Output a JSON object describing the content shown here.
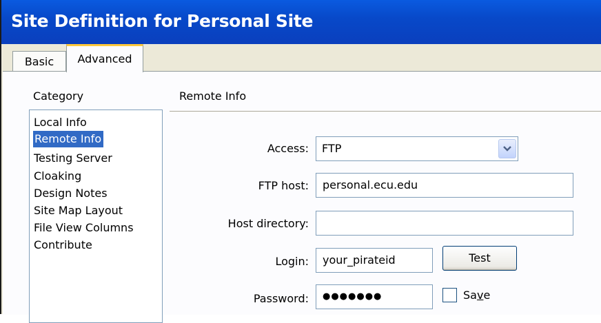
{
  "window": {
    "title": "Site Definition for Personal Site"
  },
  "tabs": [
    {
      "label": "Basic",
      "active": false
    },
    {
      "label": "Advanced",
      "active": true
    }
  ],
  "category": {
    "label": "Category",
    "items": [
      {
        "label": "Local Info",
        "selected": false
      },
      {
        "label": "Remote Info",
        "selected": true
      },
      {
        "label": "Testing Server",
        "selected": false
      },
      {
        "label": "Cloaking",
        "selected": false
      },
      {
        "label": "Design Notes",
        "selected": false
      },
      {
        "label": "Site Map Layout",
        "selected": false
      },
      {
        "label": "File View Columns",
        "selected": false
      },
      {
        "label": "Contribute",
        "selected": false
      }
    ]
  },
  "remote": {
    "heading": "Remote Info",
    "access_label": "Access:",
    "access_value": "FTP",
    "ftp_host_label": "FTP host:",
    "ftp_host_value": "personal.ecu.edu",
    "host_dir_label": "Host directory:",
    "host_dir_value": "",
    "login_label": "Login:",
    "login_value": "your_pirateid",
    "test_button": "Test",
    "password_label": "Password:",
    "password_masked": "●●●●●●●",
    "save_label_pre": "Sa",
    "save_label_u": "v",
    "save_label_post": "e",
    "save_checked": false
  },
  "colors": {
    "titlebar": "#0a4fd6",
    "selection": "#316ac5",
    "tab_highlight": "#ffc83c"
  }
}
